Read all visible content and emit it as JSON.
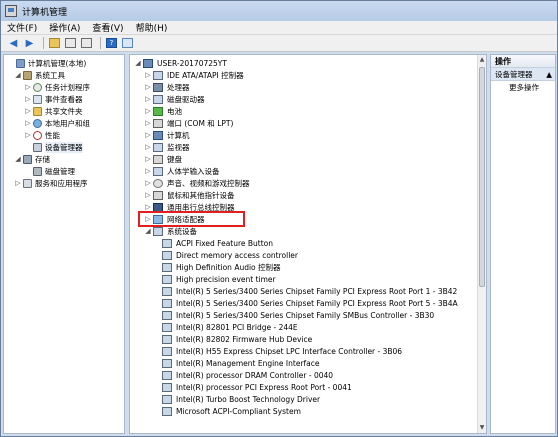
{
  "window": {
    "title": "计算机管理"
  },
  "menu": [
    "文件(F)",
    "操作(A)",
    "查看(V)",
    "帮助(H)"
  ],
  "left_tree": [
    {
      "label": "计算机管理(本地)",
      "icon": "computer-icon"
    },
    {
      "label": "系统工具",
      "icon": "tools-icon"
    },
    {
      "label": "任务计划程序",
      "icon": "clock-icon"
    },
    {
      "label": "事件查看器",
      "icon": "log-icon"
    },
    {
      "label": "共享文件夹",
      "icon": "share-folder-icon"
    },
    {
      "label": "本地用户和组",
      "icon": "users-icon"
    },
    {
      "label": "性能",
      "icon": "performance-icon"
    },
    {
      "label": "设备管理器",
      "icon": "device-manager-icon"
    },
    {
      "label": "存储",
      "icon": "storage-icon"
    },
    {
      "label": "磁盘管理",
      "icon": "disk-icon"
    },
    {
      "label": "服务和应用程序",
      "icon": "services-icon"
    }
  ],
  "device_tree": {
    "root": "USER-20170725YT",
    "categories": [
      "IDE ATA/ATAPI 控制器",
      "处理器",
      "磁盘驱动器",
      "电池",
      "端口 (COM 和 LPT)",
      "计算机",
      "监视器",
      "键盘",
      "人体学输入设备",
      "声音、视频和游戏控制器",
      "鼠标和其他指针设备",
      "通用串行总线控制器",
      "网络适配器",
      "系统设备"
    ],
    "system_devices": [
      "ACPI Fixed Feature Button",
      "Direct memory access controller",
      "High Definition Audio 控制器",
      "High precision event timer",
      "Intel(R) 5 Series/3400 Series Chipset Family PCI Express Root Port 1 - 3B42",
      "Intel(R) 5 Series/3400 Series Chipset Family PCI Express Root Port 5 - 3B4A",
      "Intel(R) 5 Series/3400 Series Chipset Family SMBus Controller - 3B30",
      "Intel(R) 82801 PCI Bridge - 244E",
      "Intel(R) 82802 Firmware Hub Device",
      "Intel(R) H55 Express Chipset LPC Interface Controller - 3B06",
      "Intel(R) Management Engine Interface",
      "Intel(R) processor DRAM Controller - 0040",
      "Intel(R) processor PCI Express Root Port - 0041",
      "Intel(R) Turbo Boost Technology Driver",
      "Microsoft ACPI-Compliant System"
    ]
  },
  "actions": {
    "header": "操作",
    "section": "设备管理器",
    "more": "更多操作"
  },
  "colors": {
    "highlight_border": "#e02020",
    "accent": "#2a6cc4"
  }
}
